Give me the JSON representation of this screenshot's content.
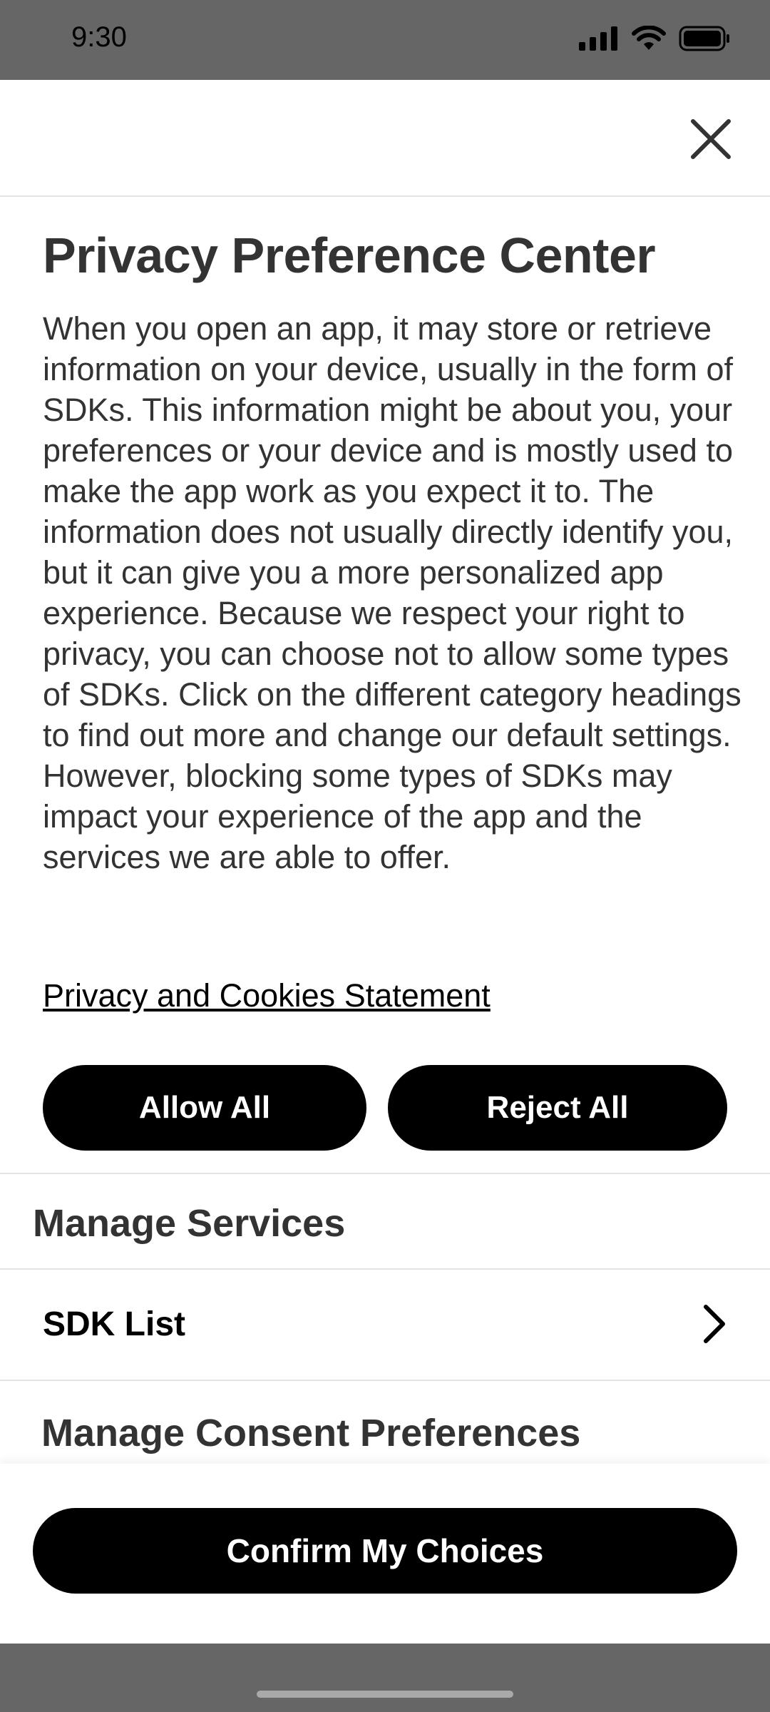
{
  "status_bar": {
    "time": "9:30",
    "icons": [
      "signal-icon",
      "wifi-icon",
      "battery-icon"
    ]
  },
  "header": {
    "close_icon": "close-icon"
  },
  "content": {
    "title": "Privacy Preference Center",
    "description": "When you open an app, it may store or retrieve information on your device, usually in the form of SDKs. This information might be about you, your preferences or your device and is mostly used to make the app work as you expect it to. The information does not usually directly identify you, but it can give you a more personalized app experience. Because we respect your right to privacy, you can choose not to allow some types of SDKs. Click on the different category headings to find out more and change our default settings. However, blocking some types of SDKs may impact your experience of the app and the services we are able to offer.",
    "policy_link": "Privacy and Cookies Statement",
    "allow_all": "Allow All",
    "reject_all": "Reject All"
  },
  "manage_services": {
    "heading": "Manage Services",
    "sdk_list_label": "SDK List"
  },
  "consent": {
    "heading": "Manage Consent Preferences"
  },
  "footer": {
    "confirm_label": "Confirm My Choices"
  },
  "colors": {
    "button_bg": "#000000",
    "button_text": "#ffffff",
    "text": "#333333",
    "status_bar_bg": "#666666",
    "divider": "#e3e3e3"
  }
}
